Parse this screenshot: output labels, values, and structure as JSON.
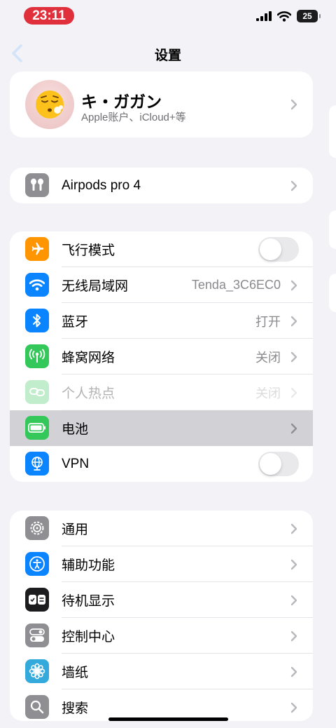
{
  "status_bar": {
    "time": "23:11",
    "battery": "25",
    "signal_icon": "cellular-signal-icon",
    "wifi_icon": "wifi-icon"
  },
  "nav": {
    "title": "设置",
    "back_icon": "chevron-left-icon"
  },
  "profile": {
    "name": "キ・ガガン",
    "subtitle": "Apple账户、iCloud+等",
    "avatar_icon": "face-exhaling-emoji"
  },
  "device": {
    "label": "Airpods pro 4",
    "icon": "airpods-icon"
  },
  "connectivity": [
    {
      "label": "飞行模式",
      "icon": "airplane-icon",
      "color": "#ff9500",
      "toggle": false
    },
    {
      "label": "无线局域网",
      "value": "Tenda_3C6EC0",
      "icon": "wifi-icon",
      "color": "#0a84ff"
    },
    {
      "label": "蓝牙",
      "value": "打开",
      "icon": "bluetooth-icon",
      "color": "#0a84ff"
    },
    {
      "label": "蜂窝网络",
      "value": "关闭",
      "icon": "cellular-antenna-icon",
      "color": "#34c759"
    },
    {
      "label": "个人热点",
      "value": "关闭",
      "icon": "personal-hotspot-icon",
      "color": "#34c759",
      "disabled": true
    },
    {
      "label": "电池",
      "icon": "battery-icon",
      "color": "#34c759",
      "highlighted": true
    },
    {
      "label": "VPN",
      "icon": "vpn-globe-icon",
      "color": "#0a84ff",
      "toggle": false
    }
  ],
  "general": [
    {
      "label": "通用",
      "icon": "gear-icon",
      "color": "#8e8e93"
    },
    {
      "label": "辅助功能",
      "icon": "accessibility-icon",
      "color": "#0a84ff"
    },
    {
      "label": "待机显示",
      "icon": "standby-icon",
      "color": "#1c1c1e"
    },
    {
      "label": "控制中心",
      "icon": "control-center-icon",
      "color": "#8e8e93"
    },
    {
      "label": "墙纸",
      "icon": "wallpaper-flower-icon",
      "color": "#34aadc"
    },
    {
      "label": "搜索",
      "icon": "search-icon",
      "color": "#8e8e93"
    }
  ]
}
